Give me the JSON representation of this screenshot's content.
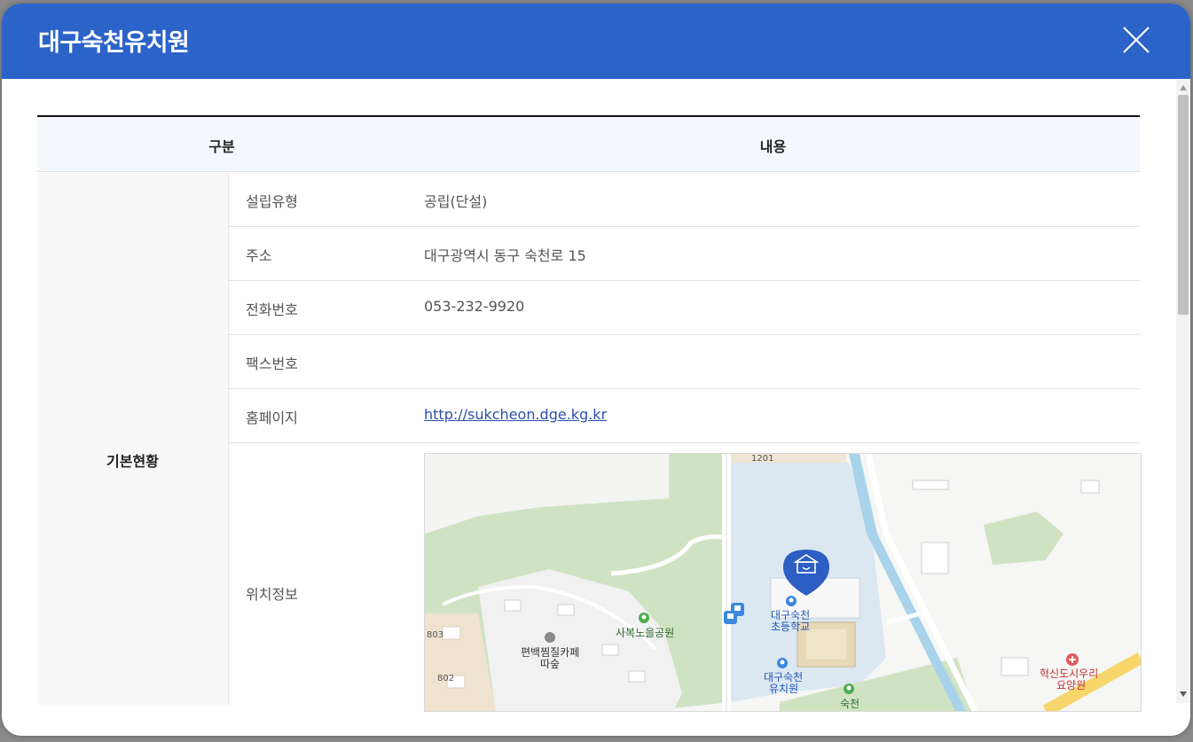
{
  "modal": {
    "title": "대구숙천유치원"
  },
  "table": {
    "headers": {
      "category": "구분",
      "content": "내용"
    },
    "category": "기본현황",
    "rows": [
      {
        "label": "설립유형",
        "value": "공립(단설)"
      },
      {
        "label": "주소",
        "value": "대구광역시 동구 숙천로 15"
      },
      {
        "label": "전화번호",
        "value": "053-232-9920"
      },
      {
        "label": "팩스번호",
        "value": ""
      },
      {
        "label": "홈페이지",
        "value": "http://sukcheon.dge.kg.kr"
      }
    ],
    "map_row_label": "위치정보"
  },
  "map": {
    "labels": {
      "park": "사복노을공원",
      "school": "대구숙천\n초등학교",
      "school_line1": "대구숙천",
      "school_line2": "초등학교",
      "kinder_line1": "대구숙천",
      "kinder_line2": "유치원",
      "cafe_line1": "편백찜질카페",
      "cafe_line2": "따숲",
      "nursing_line1": "혁신도시우리",
      "nursing_line2": "요양원",
      "forest": "숙천",
      "num_1201": "1201",
      "num_803": "803",
      "num_802": "802"
    },
    "icons": {
      "marker": "kindergarten-marker-icon",
      "bus": "bus-stop-icon",
      "school": "school-icon",
      "park": "park-icon",
      "hospital": "hospital-icon"
    },
    "colors": {
      "green": "#cfe3c2",
      "water": "#a9d3ea",
      "school_zone": "#dbe7f1",
      "accent": "#2c63c8"
    }
  }
}
